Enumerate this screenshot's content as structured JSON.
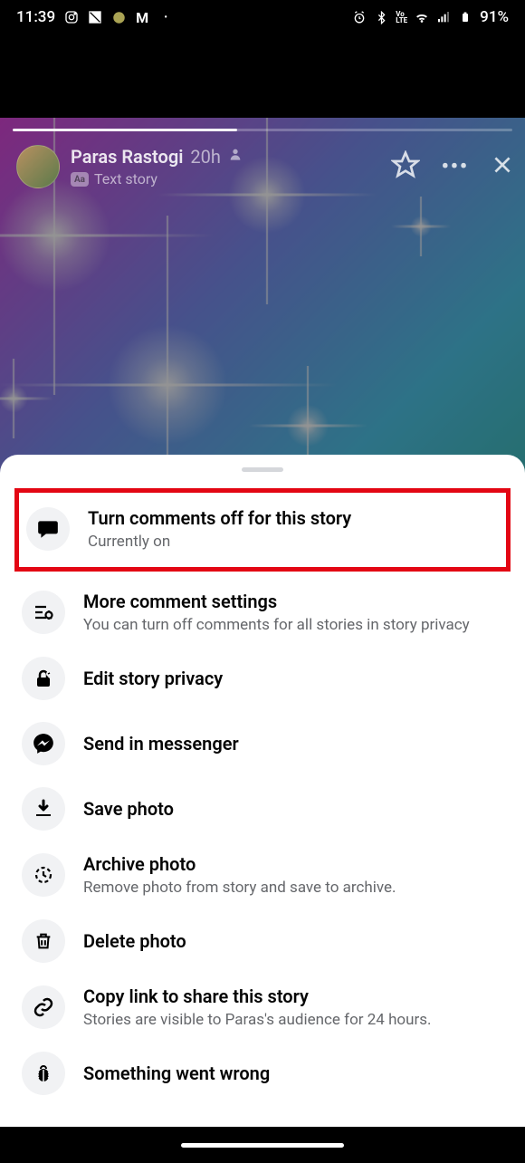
{
  "status": {
    "time": "11:39",
    "battery": "91%",
    "lte": "Vo\nLTE"
  },
  "story": {
    "user_name": "Paras Rastogi",
    "timestamp": "20h",
    "type_label": "Text story"
  },
  "menu": {
    "comments_off": {
      "title": "Turn comments off for this story",
      "sub": "Currently on"
    },
    "more_settings": {
      "title": "More comment settings",
      "sub": "You can turn off comments for all stories in story privacy"
    },
    "edit_privacy": {
      "title": "Edit story privacy"
    },
    "send_messenger": {
      "title": "Send in messenger"
    },
    "save_photo": {
      "title": "Save photo"
    },
    "archive": {
      "title": "Archive photo",
      "sub": "Remove photo from story and save to archive."
    },
    "delete": {
      "title": "Delete photo"
    },
    "copy_link": {
      "title": "Copy link to share this story",
      "sub": "Stories are visible to Paras's audience for 24 hours."
    },
    "wrong": {
      "title": "Something went wrong"
    }
  }
}
